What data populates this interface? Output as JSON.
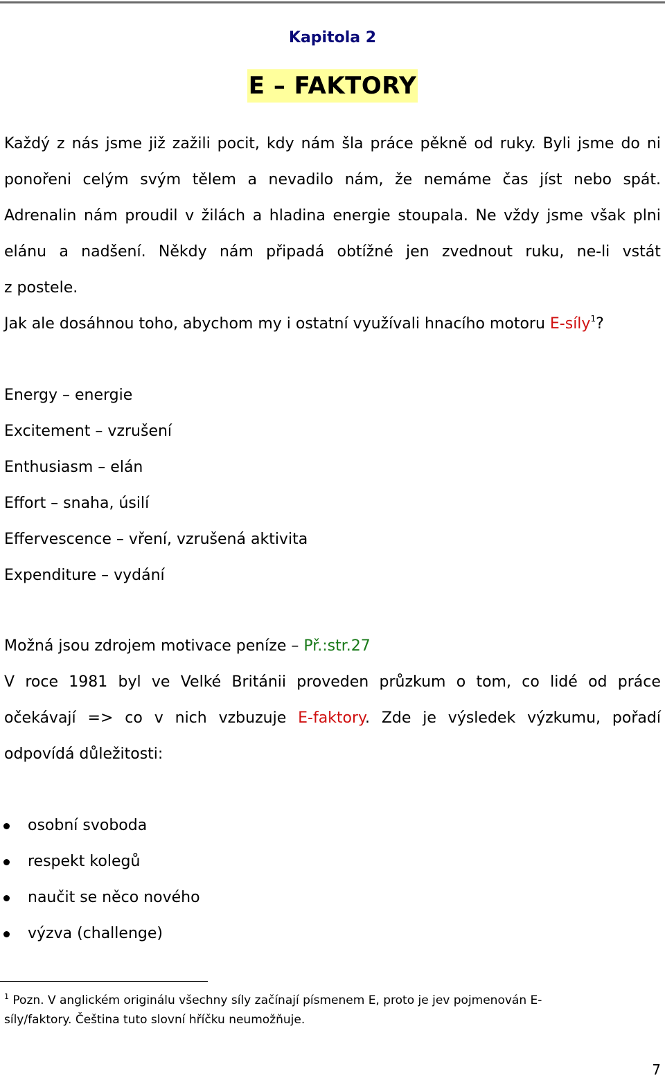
{
  "chapter_label": "Kapitola 2",
  "title": "E – FAKTORY",
  "intro": {
    "lines": [
      "Každý z nás jsme již zažili pocit, kdy nám šla práce pěkně od ruky. Byli jsme do ni",
      "ponořeni celým svým tělem a nevadilo nám, že nemáme čas jíst nebo spát.",
      "Adrenalin nám proudil v žilách a hladina energie stoupala.  Ne vždy jsme však plni",
      "elánu a nadšení. Někdy nám připadá obtížné jen zvednout ruku, ne-li  vstát",
      "z postele."
    ],
    "question_prefix": "Jak ale dosáhnou toho, abychom my i ostatní využívali hnacího motoru ",
    "question_highlight": "E-síly",
    "footnote_ref": "1",
    "question_suffix": "?"
  },
  "e_factors": [
    "Energy – energie",
    "Excitement – vzrušení",
    "Enthusiasm – elán",
    "Effort – snaha, úsilí",
    "Effervescence – vření, vzrušená aktivita",
    "Expenditure – vydání"
  ],
  "money_note": {
    "text": "Možná jsou zdrojem motivace peníze – ",
    "reference": "Př.:str.27"
  },
  "survey": {
    "line1": "V roce 1981 byl ve Velké Británii proveden průzkum o tom, co lidé od práce",
    "line2_prefix": "očekávají => co v nich vzbuzuje ",
    "line2_highlight": "E-faktory",
    "line2_suffix": ". Zde je výsledek výzkumu, pořadí",
    "line3": "odpovídá důležitosti:"
  },
  "results": [
    "osobní svoboda",
    "respekt kolegů",
    "naučit se něco nového",
    "výzva (challenge)"
  ],
  "footnote": {
    "number": "1",
    "line1": " Pozn. V anglickém originálu všechny síly začínají písmenem E, proto je jev pojmenován E-",
    "line2": "síly/faktory. Čeština tuto slovní hříčku neumožňuje."
  },
  "page_number": "7",
  "colors": {
    "chapter": "#0a0a78",
    "title_highlight": "#ffff9c",
    "accent_red": "#d01010",
    "reference_green": "#1a7a1a"
  }
}
